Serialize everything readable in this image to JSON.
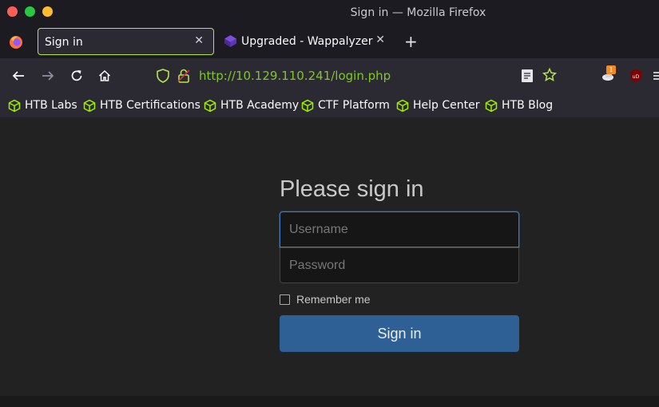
{
  "window": {
    "title": "Sign in — Mozilla Firefox"
  },
  "colors": {
    "close": "#fe5f57",
    "minimize": "#2ac840",
    "maximize": "#febc2e",
    "accent": "#b7e34a",
    "url": "#7fc62a",
    "button": "#2e6095"
  },
  "tabs": [
    {
      "label": "Sign in",
      "active": true
    },
    {
      "label": "Upgraded - Wappalyzer",
      "active": false
    }
  ],
  "urlbar": {
    "url": "http://10.129.110.241/login.php"
  },
  "extensions": {
    "badge": "1"
  },
  "bookmarks": [
    {
      "label": "HTB Labs"
    },
    {
      "label": "HTB Certifications"
    },
    {
      "label": "HTB Academy"
    },
    {
      "label": "CTF Platform"
    },
    {
      "label": "Help Center"
    },
    {
      "label": "HTB Blog"
    }
  ],
  "login": {
    "heading": "Please sign in",
    "username_placeholder": "Username",
    "password_placeholder": "Password",
    "remember_label": "Remember me",
    "submit_label": "Sign in"
  }
}
